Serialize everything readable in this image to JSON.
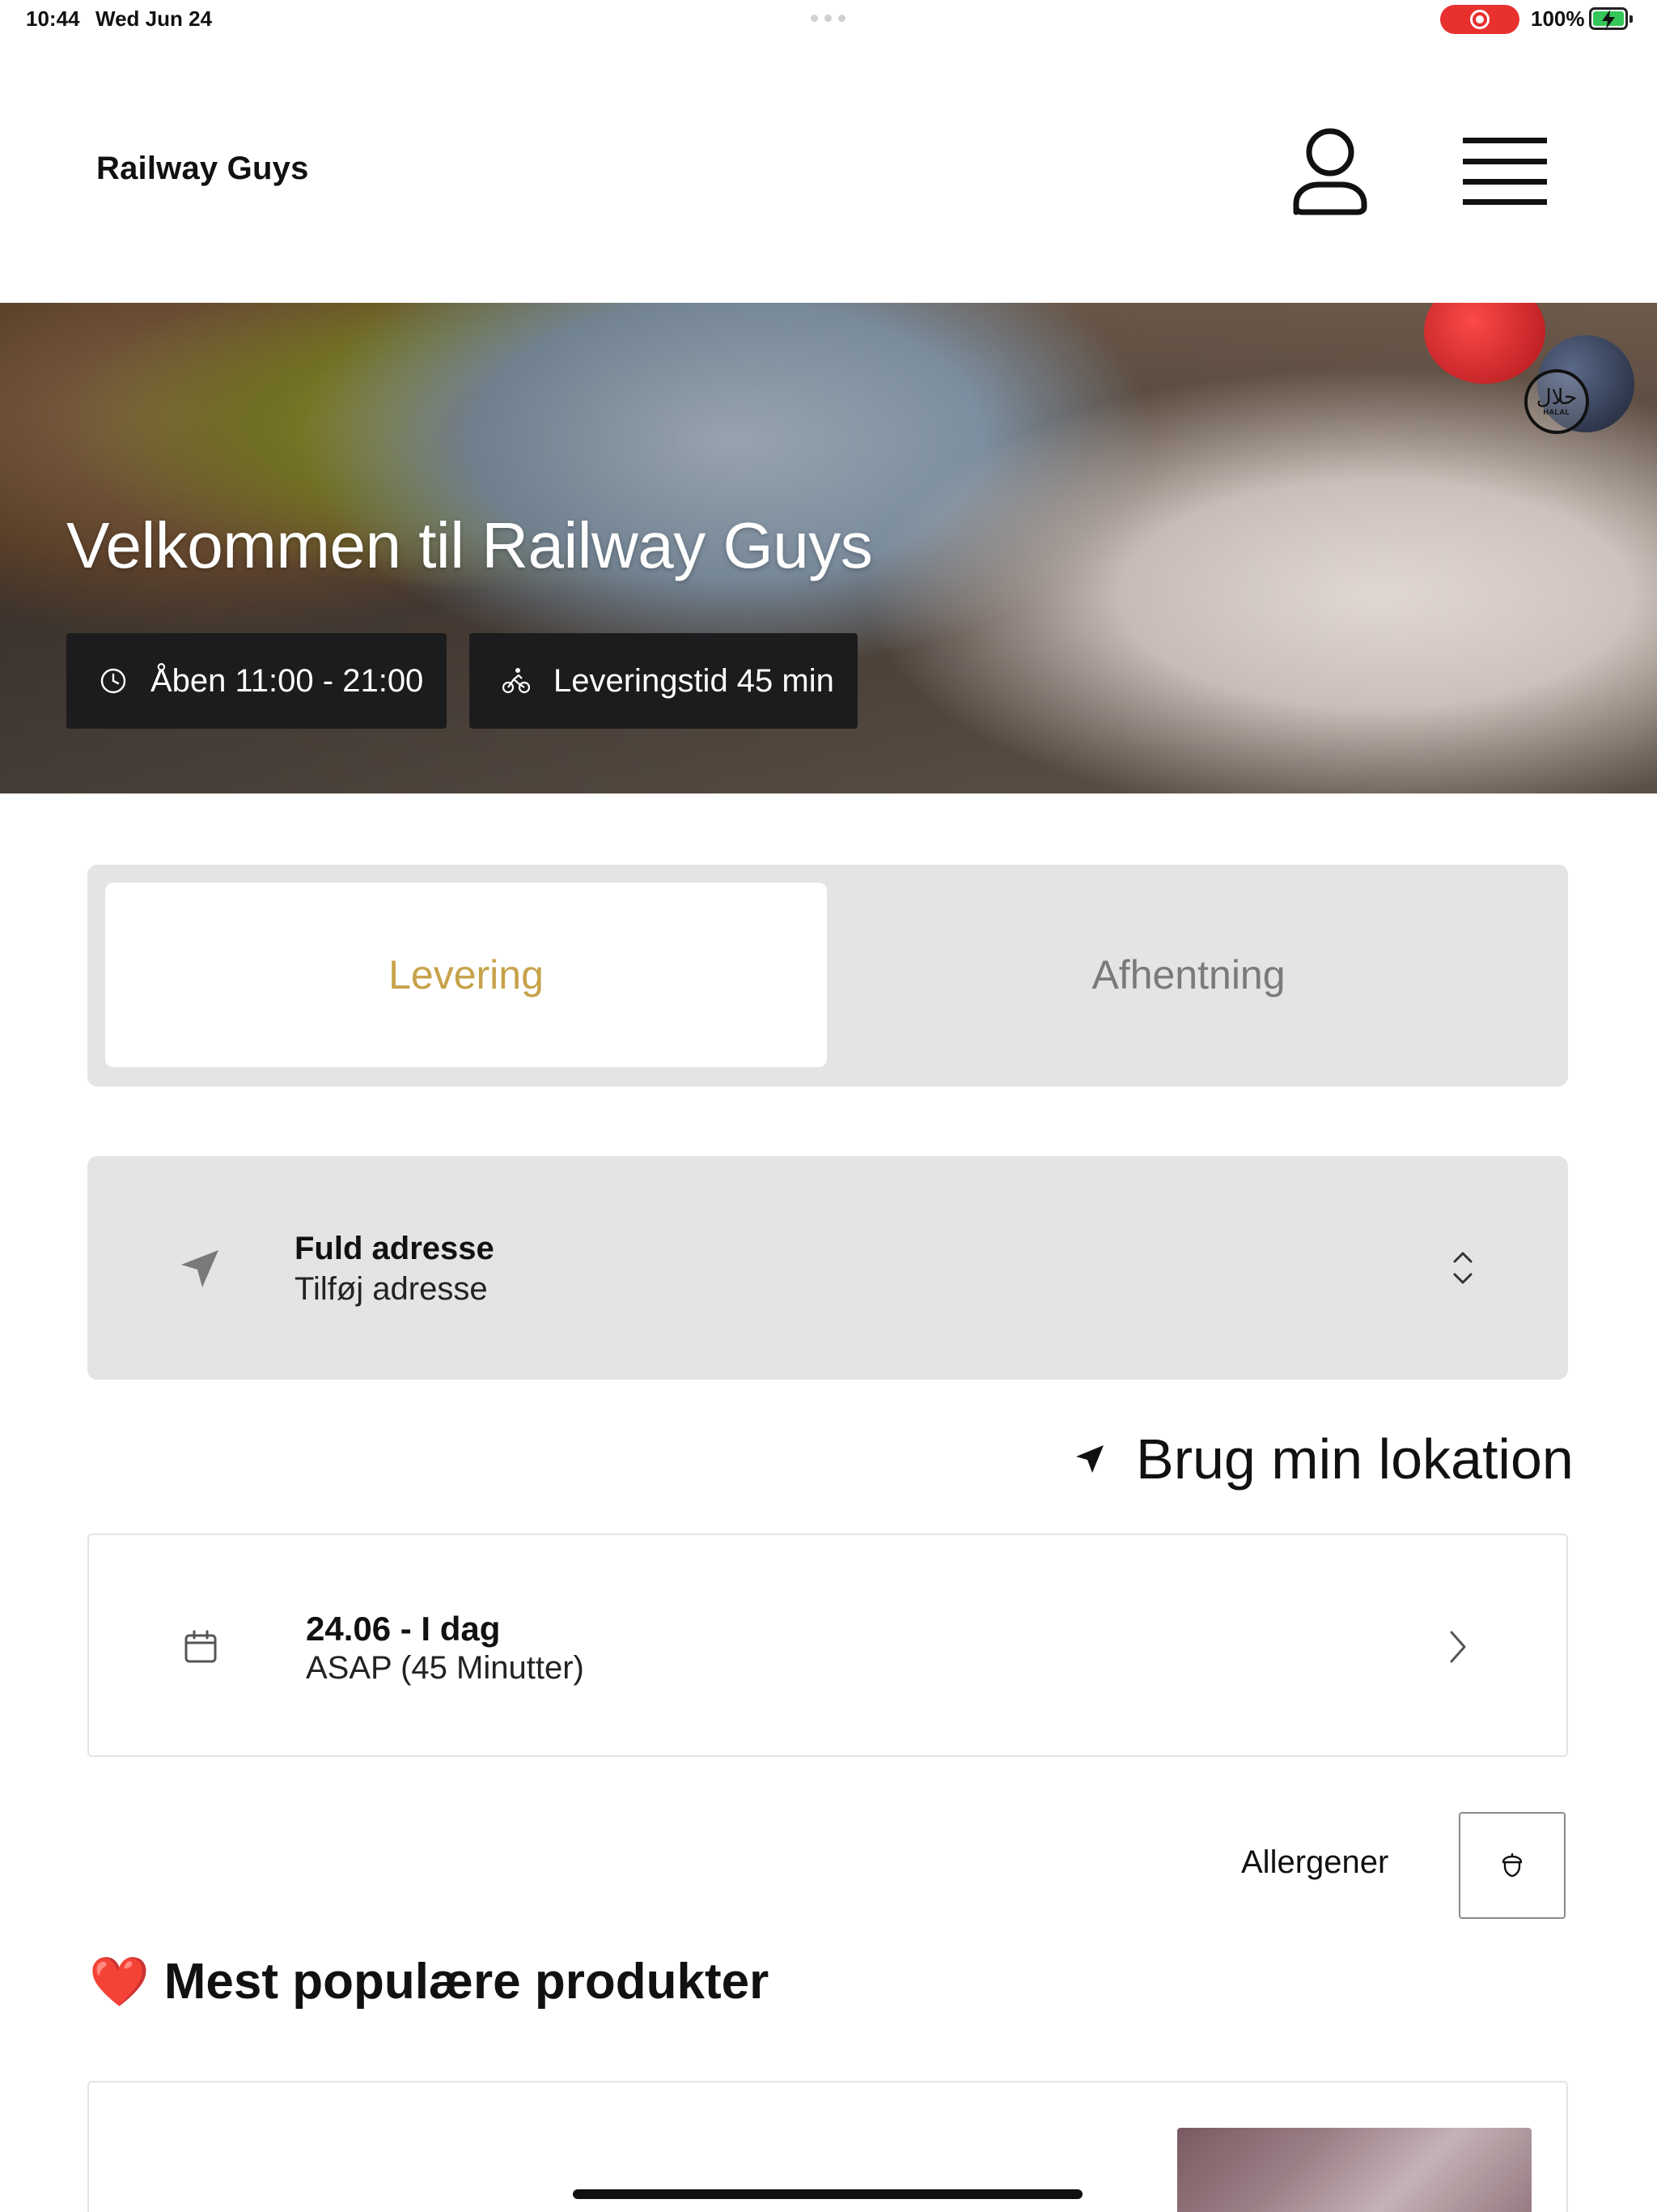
{
  "status_bar": {
    "time": "10:44",
    "date": "Wed Jun 24",
    "battery_percent": "100%",
    "battery_level": 1.0,
    "recording_color": "#e8312f",
    "battery_color": "#34c759"
  },
  "header": {
    "brand": "Railway Guys",
    "user_icon": "user-icon",
    "menu_icon": "hamburger-menu-icon"
  },
  "hero": {
    "title": "Velkommen til Railway Guys",
    "badge_arabic": "حلال",
    "badge_text": "HALAL",
    "open_hours": "Åben 11:00 - 21:00",
    "delivery_time": "Leveringstid 45 min",
    "open_icon": "clock-icon",
    "delivery_icon": "bicycle-icon"
  },
  "order_type": {
    "tabs": [
      {
        "label": "Levering",
        "selected": true
      },
      {
        "label": "Afhentning",
        "selected": false
      }
    ],
    "accent_color": "#c7a24a"
  },
  "address": {
    "label": "Fuld adresse",
    "value": "Tilføj adresse",
    "icon": "location-arrow-icon"
  },
  "use_location": {
    "label": "Brug min lokation",
    "icon": "location-arrow-icon"
  },
  "schedule": {
    "date": "24.06 - I dag",
    "time": "ASAP (45 Minutter)",
    "icon": "calendar-icon"
  },
  "allergens": {
    "label": "Allergener",
    "icon": "acorn-icon"
  },
  "popular": {
    "emoji": "❤️",
    "title": "Mest populære produkter"
  }
}
